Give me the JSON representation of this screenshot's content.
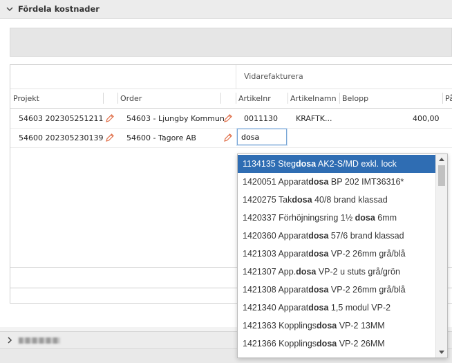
{
  "section": {
    "title": "Fördela kostnader"
  },
  "grid": {
    "group_label": "Vidarefakturera",
    "columns": [
      "Projekt",
      "Order",
      "Artikelnr",
      "Artikelnamn",
      "Belopp",
      "På"
    ],
    "rows": [
      {
        "projekt": "54603 202305251211",
        "order": "54603 - Ljungby Kommun",
        "artikelnr": "0011130",
        "artikelnamn": "KRAFTK...",
        "belopp": "400,00"
      },
      {
        "projekt": "54600 202305230139",
        "order": "54600 - Tagore AB",
        "artikelnr": "",
        "artikelnamn": "",
        "belopp": ""
      }
    ],
    "search_value": "dosa"
  },
  "dropdown": {
    "items": [
      {
        "pre": "1134135 Steg",
        "hl": "dosa",
        "post": " AK2-S/MD exkl. lock"
      },
      {
        "pre": "1420051 Apparat",
        "hl": "dosa",
        "post": " BP 202 IMT36316*"
      },
      {
        "pre": "1420275 Tak",
        "hl": "dosa",
        "post": " 40/8 brand klassad"
      },
      {
        "pre": "1420337 Förhöjningsring 1½ ",
        "hl": "dosa",
        "post": " 6mm"
      },
      {
        "pre": "1420360 Apparat",
        "hl": "dosa",
        "post": " 57/6 brand klassad"
      },
      {
        "pre": "1421303 Apparat",
        "hl": "dosa",
        "post": " VP-2 26mm grå/blå"
      },
      {
        "pre": "1421307 App.",
        "hl": "dosa",
        "post": " VP-2 u stuts grå/grön"
      },
      {
        "pre": "1421308 Apparat",
        "hl": "dosa",
        "post": " VP-2 26mm grå/blå"
      },
      {
        "pre": "1421340 Apparat",
        "hl": "dosa",
        "post": " 1,5 modul VP-2"
      },
      {
        "pre": "1421363 Kopplings",
        "hl": "dosa",
        "post": " VP-2 13MM"
      },
      {
        "pre": "1421366 Kopplings",
        "hl": "dosa",
        "post": " VP-2 26MM"
      }
    ]
  },
  "colors": {
    "selection": "#2f6db3",
    "pencil": "#e0704a"
  }
}
